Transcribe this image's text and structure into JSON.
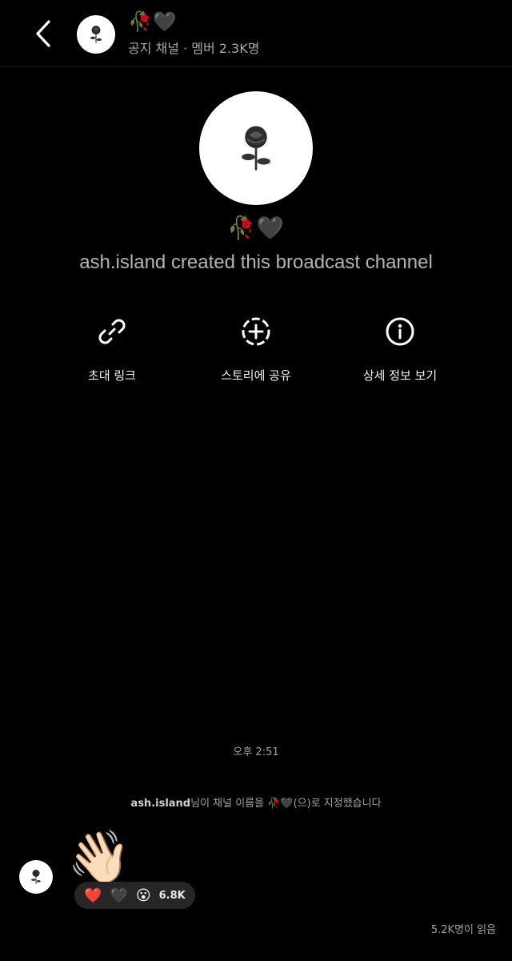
{
  "header": {
    "channel_name": "🥀🖤",
    "subtitle": "공지 채널 · 멤버 2.3K명"
  },
  "intro": {
    "channel_name": "🥀🖤",
    "created_text": "ash.island created this broadcast channel"
  },
  "actions": [
    {
      "label": "초대 링크",
      "icon": "link-icon"
    },
    {
      "label": "스토리에 공유",
      "icon": "add-story-icon"
    },
    {
      "label": "상세 정보 보기",
      "icon": "info-icon"
    }
  ],
  "chat": {
    "timestamp": "오후 2:51",
    "system_user": "ash.island",
    "system_text": "님이 채널 이름을 🥀🖤(으)로 지정했습니다",
    "message_emoji": "👋🏻",
    "reactions": {
      "emojis": [
        "❤️",
        "🖤",
        "😮"
      ],
      "count": "6.8K"
    },
    "read_count": "5.2K명이 읽음"
  },
  "colors": {
    "background": "#000000",
    "muted_text": "#a8a8a8",
    "pill": "#262626"
  }
}
